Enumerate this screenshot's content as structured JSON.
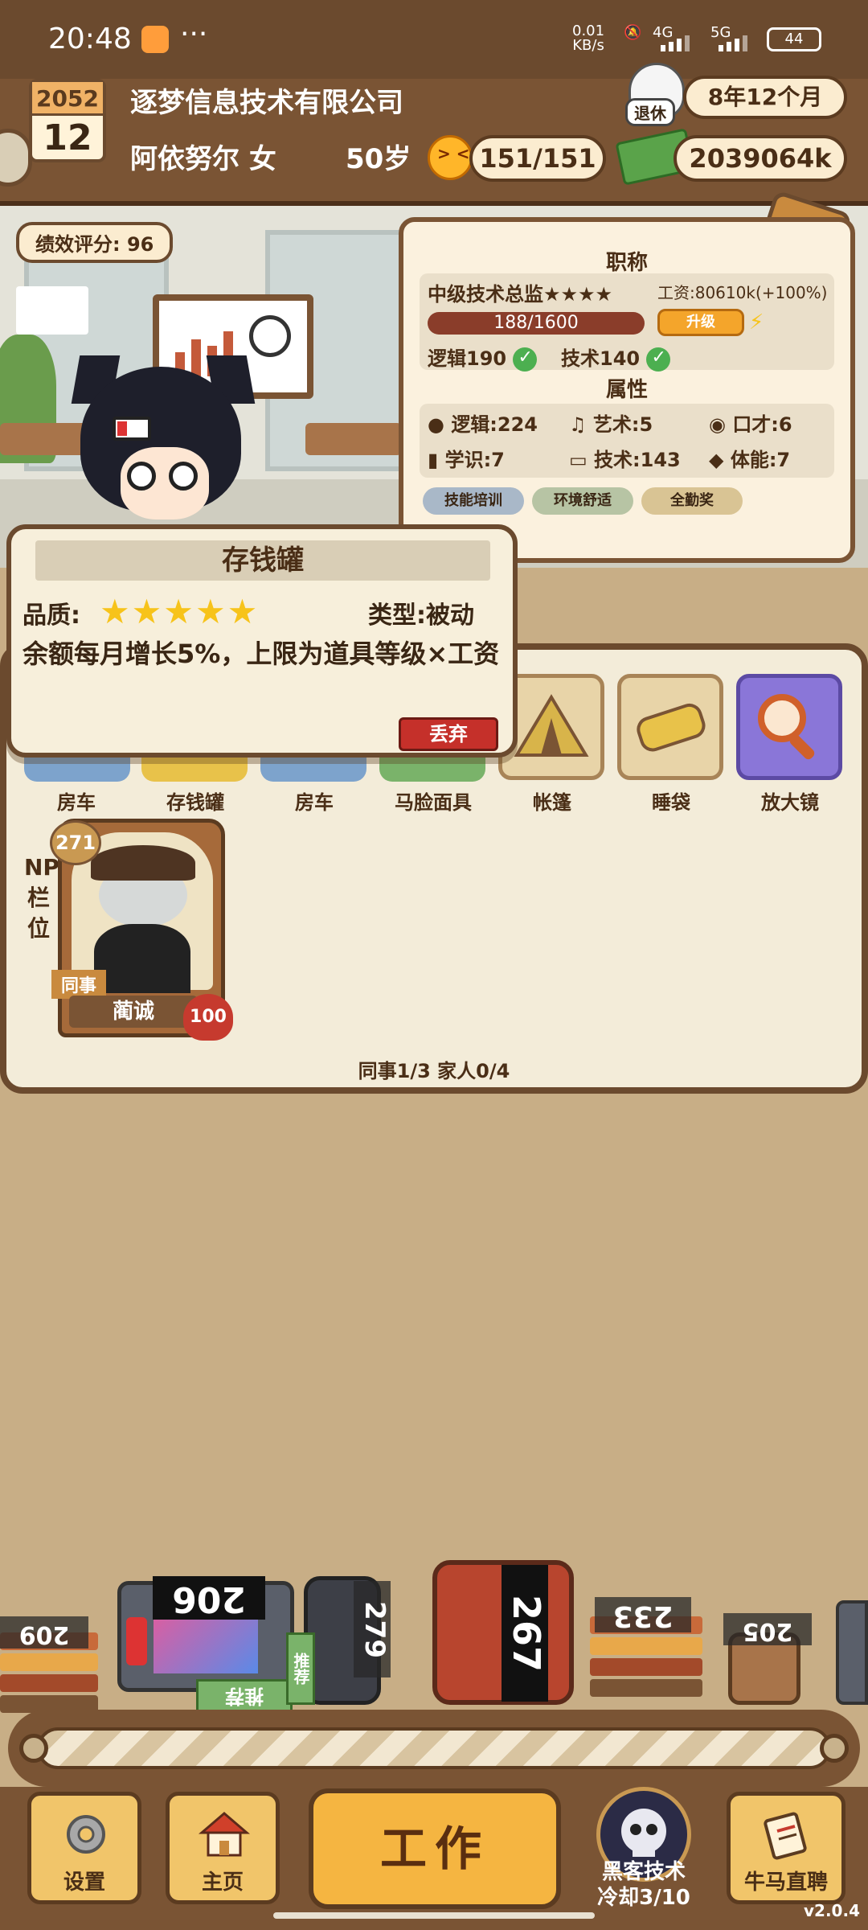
{
  "status_bar": {
    "time": "20:48",
    "more": "···",
    "net_speed_value": "0.01",
    "net_speed_unit": "KB/s",
    "signal_1": "4G",
    "signal_2": "5G",
    "battery": "44"
  },
  "header": {
    "year": "2052",
    "month": "12",
    "company": "逐梦信息技术有限公司",
    "player_name": "阿依努尔 女",
    "age": "50岁",
    "mood": "151/151",
    "retire_tag": "退休",
    "retire_countdown": "8年12个月",
    "money": "2039064k"
  },
  "scene": {
    "performance_score": "绩效评分: 96"
  },
  "job_card": {
    "title_header": "职称",
    "job_title": "中级技术总监★★★★",
    "salary": "工资:80610k(+100%)",
    "progress_text": "188/1600",
    "upgrade_button": "升级",
    "req_logic": "逻辑190",
    "req_tech": "技术140",
    "attributes_header": "属性",
    "attrs": {
      "logic": "逻辑:224",
      "art": "艺术:5",
      "eloquence": "口才:6",
      "knowledge": "学识:7",
      "technique": "技术:143",
      "stamina": "体能:7"
    },
    "tags": [
      "技能培训",
      "环境舒适",
      "全勤奖"
    ]
  },
  "popup": {
    "title": "存钱罐",
    "quality_label": "品质:",
    "stars": "★★★★★",
    "type": "类型:被动",
    "description": "余额每月增长5%，上限为道具等级×工资",
    "discard_button": "丢弃"
  },
  "items": [
    {
      "label": "房车"
    },
    {
      "label": "存钱罐"
    },
    {
      "label": "房车"
    },
    {
      "label": "马脸面具"
    },
    {
      "label": "帐篷"
    },
    {
      "label": "睡袋"
    },
    {
      "label": "放大镜"
    }
  ],
  "npc": {
    "side_label": "NPC栏位",
    "level": "271",
    "role": "同事",
    "name": "蔺诚",
    "affection": "100",
    "counts": "同事1/3 家人0/4"
  },
  "conveyor": {
    "values": [
      "209",
      "206",
      "279",
      "267",
      "233",
      "205"
    ],
    "recommend_1": "推荐",
    "recommend_2": "推荐"
  },
  "nav": {
    "settings": "设置",
    "home": "主页",
    "work": "工作",
    "hacker_title": "黑客技术",
    "hacker_cooldown": "冷却3/10",
    "recruit": "牛马直聘",
    "version": "v2.0.4"
  },
  "colors": {
    "wood_dark": "#6b4a2e",
    "wood": "#7a5434",
    "paper": "#fbf1de",
    "star": "#f7c31a",
    "discard_red": "#c5302a",
    "button_orange": "#f5b541"
  }
}
